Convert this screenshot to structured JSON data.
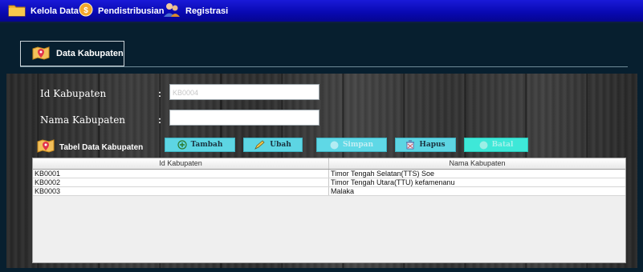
{
  "menu": {
    "items": [
      {
        "label": "Kelola Data",
        "icon": "folder-icon"
      },
      {
        "label": "Pendistribusian",
        "icon": "money-coin-icon"
      },
      {
        "label": "Registrasi",
        "icon": "users-icon"
      }
    ]
  },
  "tab": {
    "label": "Data Kabupaten",
    "icon": "map-pin-icon"
  },
  "form": {
    "id_label": "Id Kabupaten",
    "id_value": "KB0004",
    "nama_label": "Nama Kabupaten",
    "nama_value": "",
    "colon": ":"
  },
  "section": {
    "title": "Tabel Data Kabupaten",
    "icon": "map-pin-icon"
  },
  "toolbar": {
    "tambah": "Tambah",
    "ubah": "Ubah",
    "simpan": "Simpan",
    "hapus": "Hapus",
    "batal": "Batal"
  },
  "table": {
    "headers": [
      "Id Kabupaten",
      "Nama Kabupaten"
    ],
    "rows": [
      [
        "KB0001",
        "Timor Tengah Selatan(TTS) Soe"
      ],
      [
        "KB0002",
        "Timor Tengah Utara(TTU) kefamenanu"
      ],
      [
        "KB0003",
        "Malaka"
      ]
    ]
  },
  "colors": {
    "menubar": "#0808b0",
    "background": "#071f2f",
    "button": "#5dd5e3",
    "batal_button": "#3ee8d8"
  }
}
